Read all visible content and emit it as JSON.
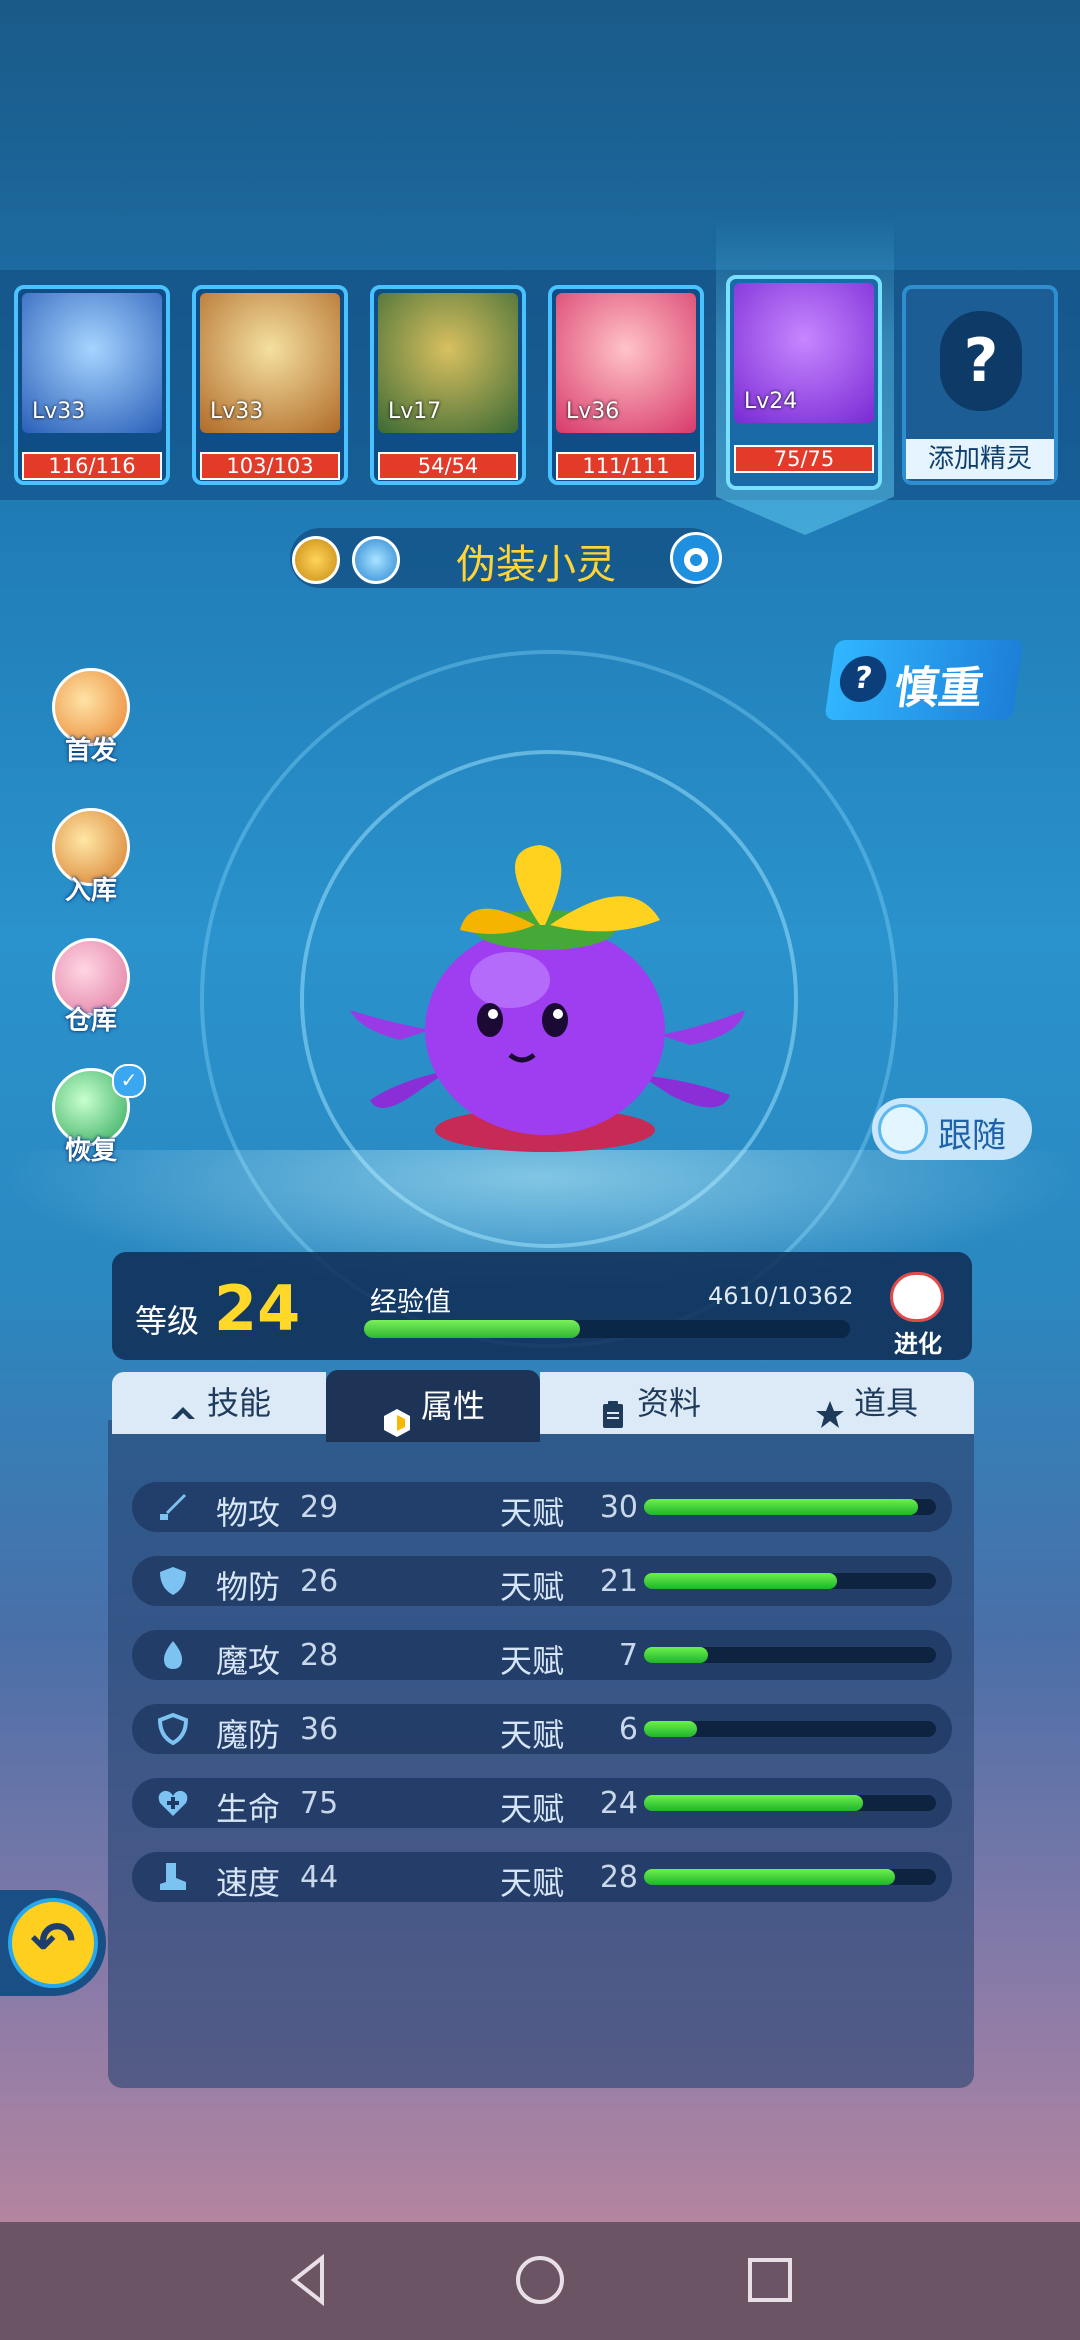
{
  "pets": [
    {
      "level": "Lv33",
      "hp": "116/116",
      "color": "#3a7fe0"
    },
    {
      "level": "Lv33",
      "hp": "103/103",
      "color": "#c8a04a"
    },
    {
      "level": "Lv17",
      "hp": "54/54",
      "color": "#5a8a3a"
    },
    {
      "level": "Lv36",
      "hp": "111/111",
      "color": "#e05a8a"
    },
    {
      "level": "Lv24",
      "hp": "75/75",
      "color": "#8a3ae0"
    }
  ],
  "add_pet_label": "添加精灵",
  "pet_name": "伪装小灵",
  "side_buttons": [
    "首发",
    "入库",
    "仓库",
    "恢复"
  ],
  "nature": "慎重",
  "follow_label": "跟随",
  "level_label": "等级",
  "level": "24",
  "exp_label": "经验值",
  "exp_value": "4610/10362",
  "exp_fraction": 0.445,
  "evolve_label": "进化",
  "tabs": [
    "技能",
    "属性",
    "资料",
    "道具"
  ],
  "active_tab": 1,
  "talent_label": "天赋",
  "stats": [
    {
      "name": "物攻",
      "value": "29",
      "talent": "30",
      "fraction": 0.94,
      "icon": "sword-icon"
    },
    {
      "name": "物防",
      "value": "26",
      "talent": "21",
      "fraction": 0.66,
      "icon": "shield-icon"
    },
    {
      "name": "魔攻",
      "value": "28",
      "talent": "7",
      "fraction": 0.22,
      "icon": "flame-icon"
    },
    {
      "name": "魔防",
      "value": "36",
      "talent": "6",
      "fraction": 0.18,
      "icon": "magic-shield-icon"
    },
    {
      "name": "生命",
      "value": "75",
      "talent": "24",
      "fraction": 0.75,
      "icon": "heart-plus-icon"
    },
    {
      "name": "速度",
      "value": "44",
      "talent": "28",
      "fraction": 0.86,
      "icon": "boot-icon"
    }
  ]
}
